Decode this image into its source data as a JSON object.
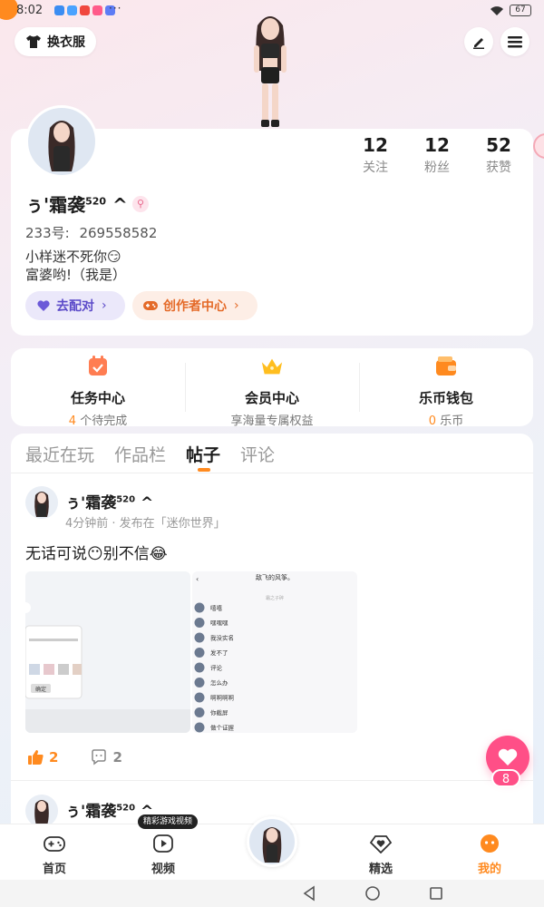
{
  "status_bar": {
    "time": "8:02",
    "more": "···",
    "battery": "67"
  },
  "top_bar": {
    "dress_up_label": "换衣服"
  },
  "profile": {
    "username": "ぅ'霜袭",
    "username_sup": "520",
    "username_suffix": " ^",
    "uid_label": "233号:",
    "uid": "269558582",
    "bio_line1": "小样迷不死你😏",
    "bio_line2": "富婆哟!（我是）",
    "stats": [
      {
        "value": "12",
        "label": "关注"
      },
      {
        "value": "12",
        "label": "粉丝"
      },
      {
        "value": "52",
        "label": "获赞"
      }
    ],
    "match_button": "去配对",
    "creator_button": "创作者中心"
  },
  "quick_links": [
    {
      "title": "任务中心",
      "sub_num": "4",
      "sub_text": " 个待完成",
      "icon": "calendar-icon",
      "color": "#ff7d52"
    },
    {
      "title": "会员中心",
      "sub_num": "",
      "sub_text": "享海量专属权益",
      "icon": "crown-icon",
      "color": "#ffbe1f"
    },
    {
      "title": "乐币钱包",
      "sub_num": "0",
      "sub_text": " 乐币",
      "icon": "wallet-icon",
      "color": "#ff8a1f"
    }
  ],
  "tabs": [
    {
      "label": "最近在玩",
      "active": false
    },
    {
      "label": "作品栏",
      "active": false
    },
    {
      "label": "帖子",
      "active": true
    },
    {
      "label": "评论",
      "active": false
    }
  ],
  "post": {
    "author": "ぅ'霜袭",
    "author_sup": "520",
    "author_suffix": " ^",
    "meta": "4分钟前 · 发布在「迷你世界」",
    "text": "无话可说😶别不信😂",
    "likes": "2",
    "comments": "2",
    "screenshot_title": "敌飞的风筝。",
    "screenshot_sub": "霜之子碎",
    "screenshot_items": [
      "嘻嘻",
      "嘿嘿嘿",
      "我没实名",
      "发不了",
      "评论",
      "怎么办",
      "啊啊啊啊",
      "你截屏",
      "做个证握"
    ],
    "dialog_button": "确定"
  },
  "second_post": {
    "author": "ぅ'霜袭",
    "author_sup": "520",
    "author_suffix": " ^"
  },
  "fab": {
    "count": "8"
  },
  "bottom_nav": {
    "tooltip": "精彩游戏视频",
    "items": [
      {
        "label": "首页",
        "icon": "gamepad-icon"
      },
      {
        "label": "视频",
        "icon": "play-icon"
      },
      {
        "label": "精选",
        "icon": "heart-diamond-icon"
      },
      {
        "label": "我的",
        "icon": "face-icon"
      }
    ]
  },
  "colors": {
    "accent": "#ff8a1f",
    "pink": "#ff4f87",
    "purple": "#5c4bc9"
  }
}
